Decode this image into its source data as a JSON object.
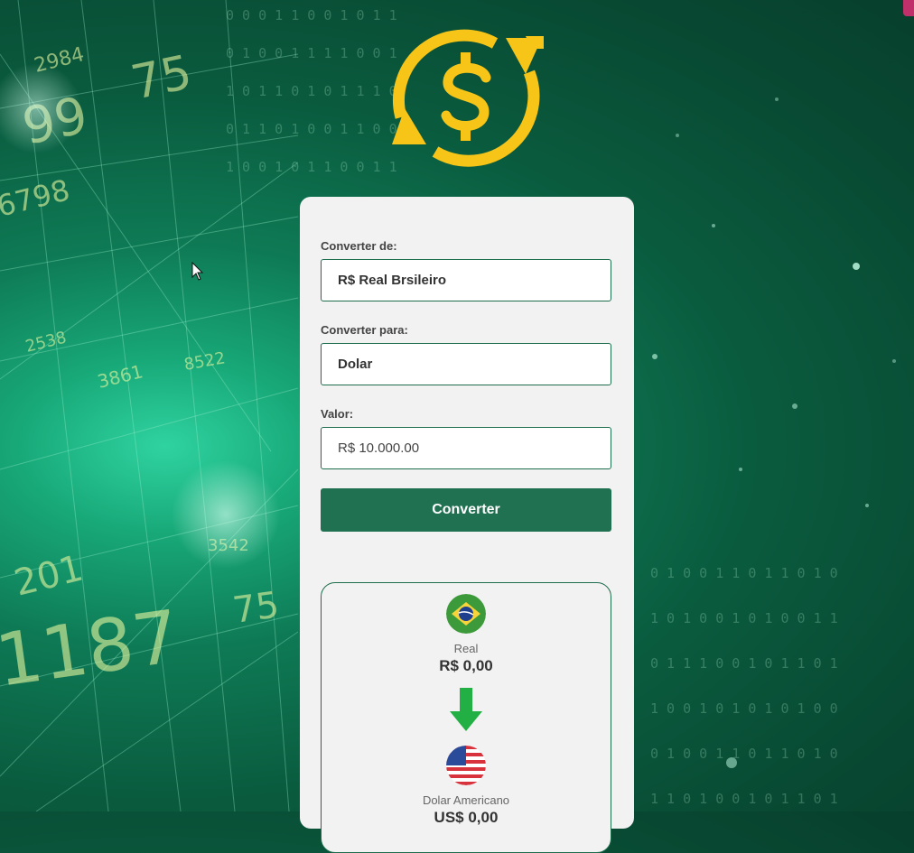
{
  "colors": {
    "accent": "#1f7151",
    "logo_yellow": "#f7c418",
    "arrow_green": "#22b044",
    "card_bg": "#f1f2f1"
  },
  "icons": {
    "logo": "dollar-exchange-icon",
    "from_flag": "brazil-flag-icon",
    "to_flag": "usa-flag-icon",
    "direction": "arrow-down-icon"
  },
  "form": {
    "from_label": "Converter de:",
    "from_value": "R$ Real Brsileiro",
    "to_label": "Converter para:",
    "to_value": "Dolar",
    "amount_label": "Valor:",
    "amount_value": "R$ 10.000.00",
    "submit_label": "Converter"
  },
  "result": {
    "from_currency": "Real",
    "from_amount": "R$ 0,00",
    "to_currency": "Dolar Americano",
    "to_amount": "US$ 0,00"
  }
}
